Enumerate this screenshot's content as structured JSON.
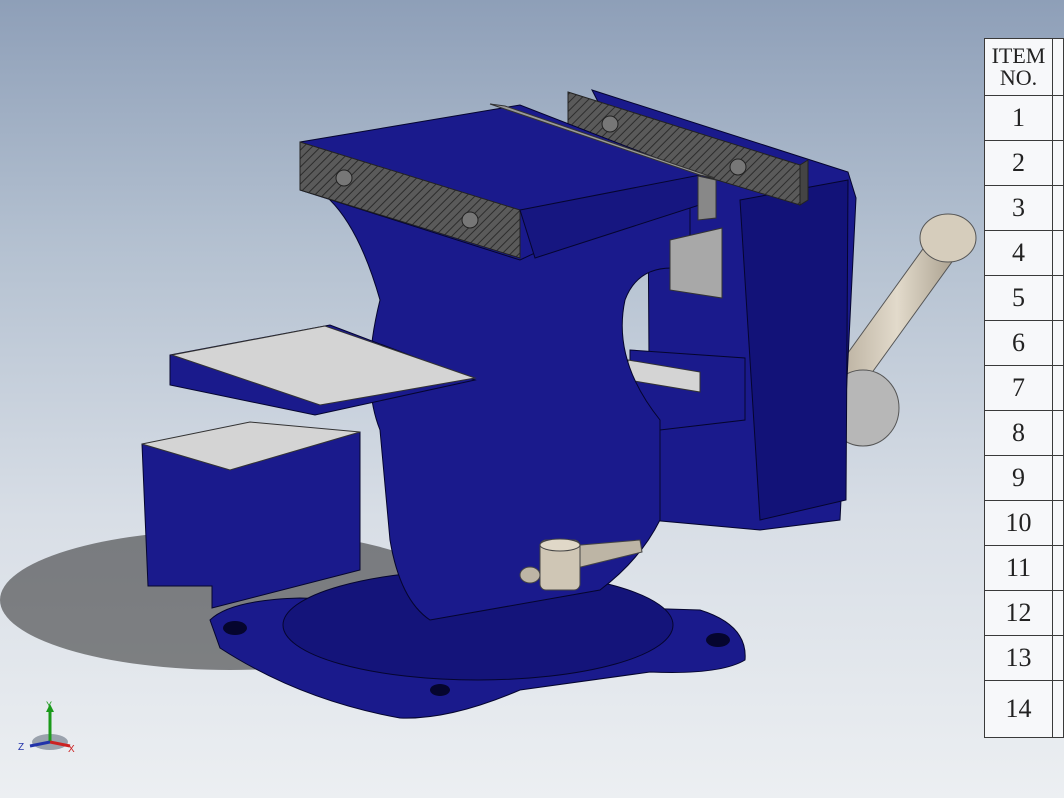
{
  "bom": {
    "header_line1": "ITEM",
    "header_line2": "NO.",
    "items": [
      "1",
      "2",
      "3",
      "4",
      "5",
      "6",
      "7",
      "8",
      "9",
      "10",
      "11",
      "12",
      "13",
      "14"
    ]
  },
  "triad": {
    "x": "X",
    "y": "Y",
    "z": "Z"
  },
  "colors": {
    "vise_body": "#1a1a8c",
    "vise_dark": "#0f0f5e",
    "steel": "#c8c8c8",
    "jaw_insert": "#555555",
    "handle": "#c9bfae"
  }
}
